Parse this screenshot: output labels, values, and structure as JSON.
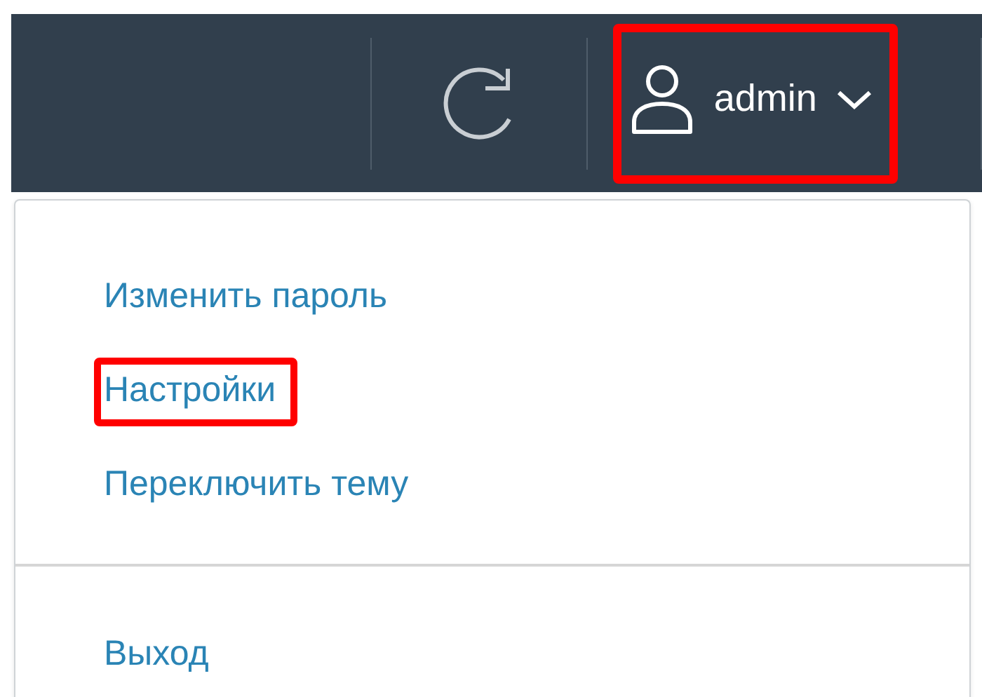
{
  "header": {
    "user_button": {
      "label": "admin",
      "highlighted": true
    }
  },
  "menu": {
    "sections": [
      [
        {
          "label": "Изменить пароль",
          "highlighted": false
        },
        {
          "label": "Настройки",
          "highlighted": true
        },
        {
          "label": "Переключить тему",
          "highlighted": false
        }
      ],
      [
        {
          "label": "Выход",
          "highlighted": false
        }
      ]
    ]
  }
}
